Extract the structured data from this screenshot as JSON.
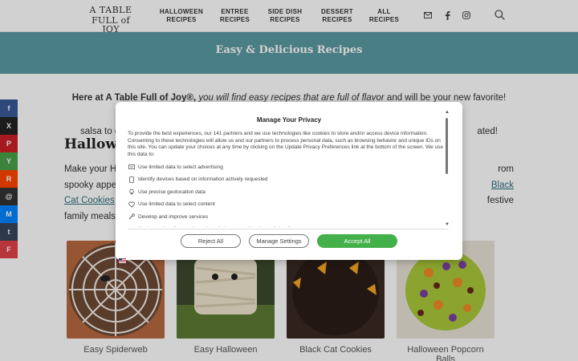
{
  "header": {
    "logo_line1": "A TABLE",
    "logo_line2": "FULL of JOY",
    "nav": [
      {
        "label": "HALLOWEEN\nRECIPES"
      },
      {
        "label": "ENTREE\nRECIPES"
      },
      {
        "label": "SIDE DISH\nRECIPES"
      },
      {
        "label": "DESSERT\nRECIPES"
      },
      {
        "label": "ALL\nRECIPES"
      }
    ],
    "icons": [
      "email-icon",
      "facebook-icon",
      "instagram-icon",
      "search-icon"
    ]
  },
  "banner": {
    "title": "Easy & Delicious Recipes"
  },
  "intro": {
    "bold": "Here at A Table Full of Joy®,",
    "italic": " you will find easy recipes that are full of flavor",
    "rest1": " and will be your new favorite! From",
    "line2_start": "salsa to c",
    "line2_end": "ated!"
  },
  "section": {
    "title": "Hallowe"
  },
  "para": {
    "line1_start": "Make your Ha",
    "line1_end": "rom",
    "line2_start": "spooky appet",
    "line2_link": "Black",
    "line3_link": "Cat Cookies",
    "line3_mid": " a",
    "line3_end": "festive",
    "line4": "family meals."
  },
  "cards": [
    {
      "name": "Easy Spiderweb"
    },
    {
      "name": "Easy Halloween"
    },
    {
      "name": "Black Cat Cookies"
    },
    {
      "name": "Halloween Popcorn Balls"
    }
  ],
  "share": [
    {
      "label": "f",
      "color": "#3b5998",
      "icon": "facebook-icon"
    },
    {
      "label": "X",
      "color": "#222222",
      "icon": "x-icon"
    },
    {
      "label": "P",
      "color": "#cb2027",
      "icon": "pinterest-icon"
    },
    {
      "label": "Y",
      "color": "#4aa14a",
      "icon": "yummly-icon"
    },
    {
      "label": "R",
      "color": "#ff4500",
      "icon": "reddit-icon"
    },
    {
      "label": "@",
      "color": "#333333",
      "icon": "threads-icon"
    },
    {
      "label": "M",
      "color": "#0084ff",
      "icon": "messenger-icon"
    },
    {
      "label": "t",
      "color": "#35465c",
      "icon": "tumblr-icon"
    },
    {
      "label": "F",
      "color": "#e0434a",
      "icon": "flipboard-icon"
    }
  ],
  "modal": {
    "title": "Manage Your Privacy",
    "description": "To provide the best experiences, our 141 partners and we use technologies like cookies to store and/or access device information. Consenting to these technologies will allow us and our partners to process personal data, such as browsing behavior and unique IDs on this site. You can update your choices at any time by clicking on the Update Privacy Preferences link at the bottom of the screen. We use this data to:",
    "purposes": [
      {
        "label": "Use limited data to select advertising",
        "icon": "ad-icon"
      },
      {
        "label": "Identify devices based on information actively requested",
        "icon": "device-icon"
      },
      {
        "label": "Use precise geolocation data",
        "icon": "location-icon"
      },
      {
        "label": "Use limited data to select content",
        "icon": "content-icon"
      },
      {
        "label": "Develop and improve services",
        "icon": "tool-icon"
      },
      {
        "label": "Understand audiences through statistics or combinations of data from",
        "icon": "share-icon"
      }
    ],
    "reject_label": "Reject All",
    "manage_label": "Manage Settings",
    "accept_label": "Accept All",
    "accept_color": "#44b04a"
  }
}
